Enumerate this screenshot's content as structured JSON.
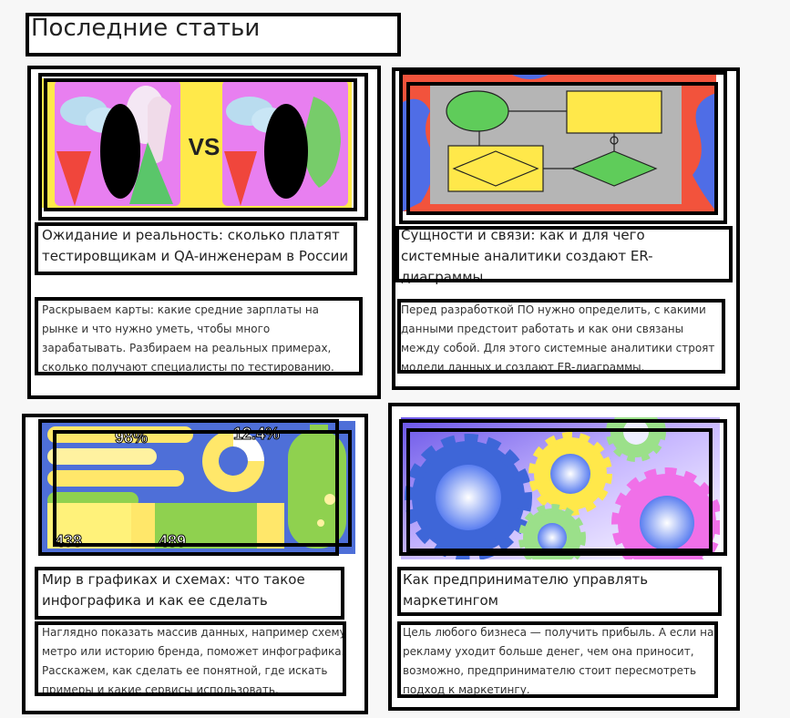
{
  "page": {
    "title": "Последние статьи"
  },
  "cards": [
    {
      "title": "Ожидание и реальность: сколько платят тестировщикам и QA-инженерам в России",
      "description": "Раскрываем карты: какие средние зарплаты на рынке и что нужно уметь, чтобы много зарабатывать. Разбираем на реальных примерах, сколько получают специалисты по тестированию.",
      "image_text": "VS"
    },
    {
      "title": "Сущности и связи: как и для чего системные аналитики создают ER-диаграммы",
      "description": "Перед разработкой ПО нужно определить, с какими данными предстоит работать и как они связаны между собой. Для этого системные аналитики строят модели данных и создают ER-диаграммы."
    },
    {
      "title": "Мир в графиках и схемах: что такое инфографика и как ее сделать",
      "description": "Наглядно показать массив данных, например схему метро или историю бренда, поможет инфографика. Расскажем, как сделать ее понятной, где искать примеры и какие сервисы использовать.",
      "image_stats": [
        "98%",
        "12.4%",
        "438",
        "489"
      ]
    },
    {
      "title": "Как предпринимателю управлять маркетингом",
      "description": "Цель любого бизнеса — получить прибыль. А если на рекламу уходит больше денег, чем она приносит, возможно, предпринимателю стоит пересмотреть подход к маркетингу."
    }
  ]
}
